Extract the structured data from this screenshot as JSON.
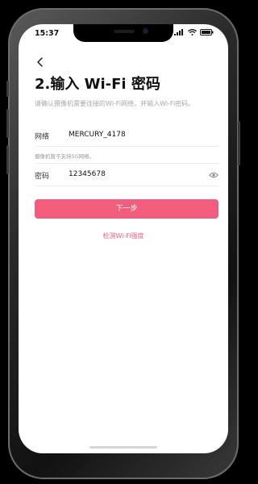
{
  "status_bar": {
    "time": "15:37",
    "icons": [
      "signal-icon",
      "wifi-icon",
      "battery-icon"
    ]
  },
  "nav": {
    "back_icon": "chevron-left-icon"
  },
  "page": {
    "title": "2.输入 Wi-Fi 密码",
    "description": "请确认摄像机需要连接的Wi-Fi网络，并输入Wi-Fi密码。"
  },
  "form": {
    "network": {
      "label": "网络",
      "value": "MERCURY_4178"
    },
    "network_hint": "摄像机暂不支持5G网络。",
    "password": {
      "label": "密码",
      "value": "12345678",
      "toggle_icon": "eye-icon"
    }
  },
  "actions": {
    "next_label": "下一步",
    "detect_link": "检测Wi-Fi强度"
  },
  "colors": {
    "accent": "#f25c7d",
    "text_primary": "#111111",
    "text_secondary": "#a8a8a8"
  }
}
